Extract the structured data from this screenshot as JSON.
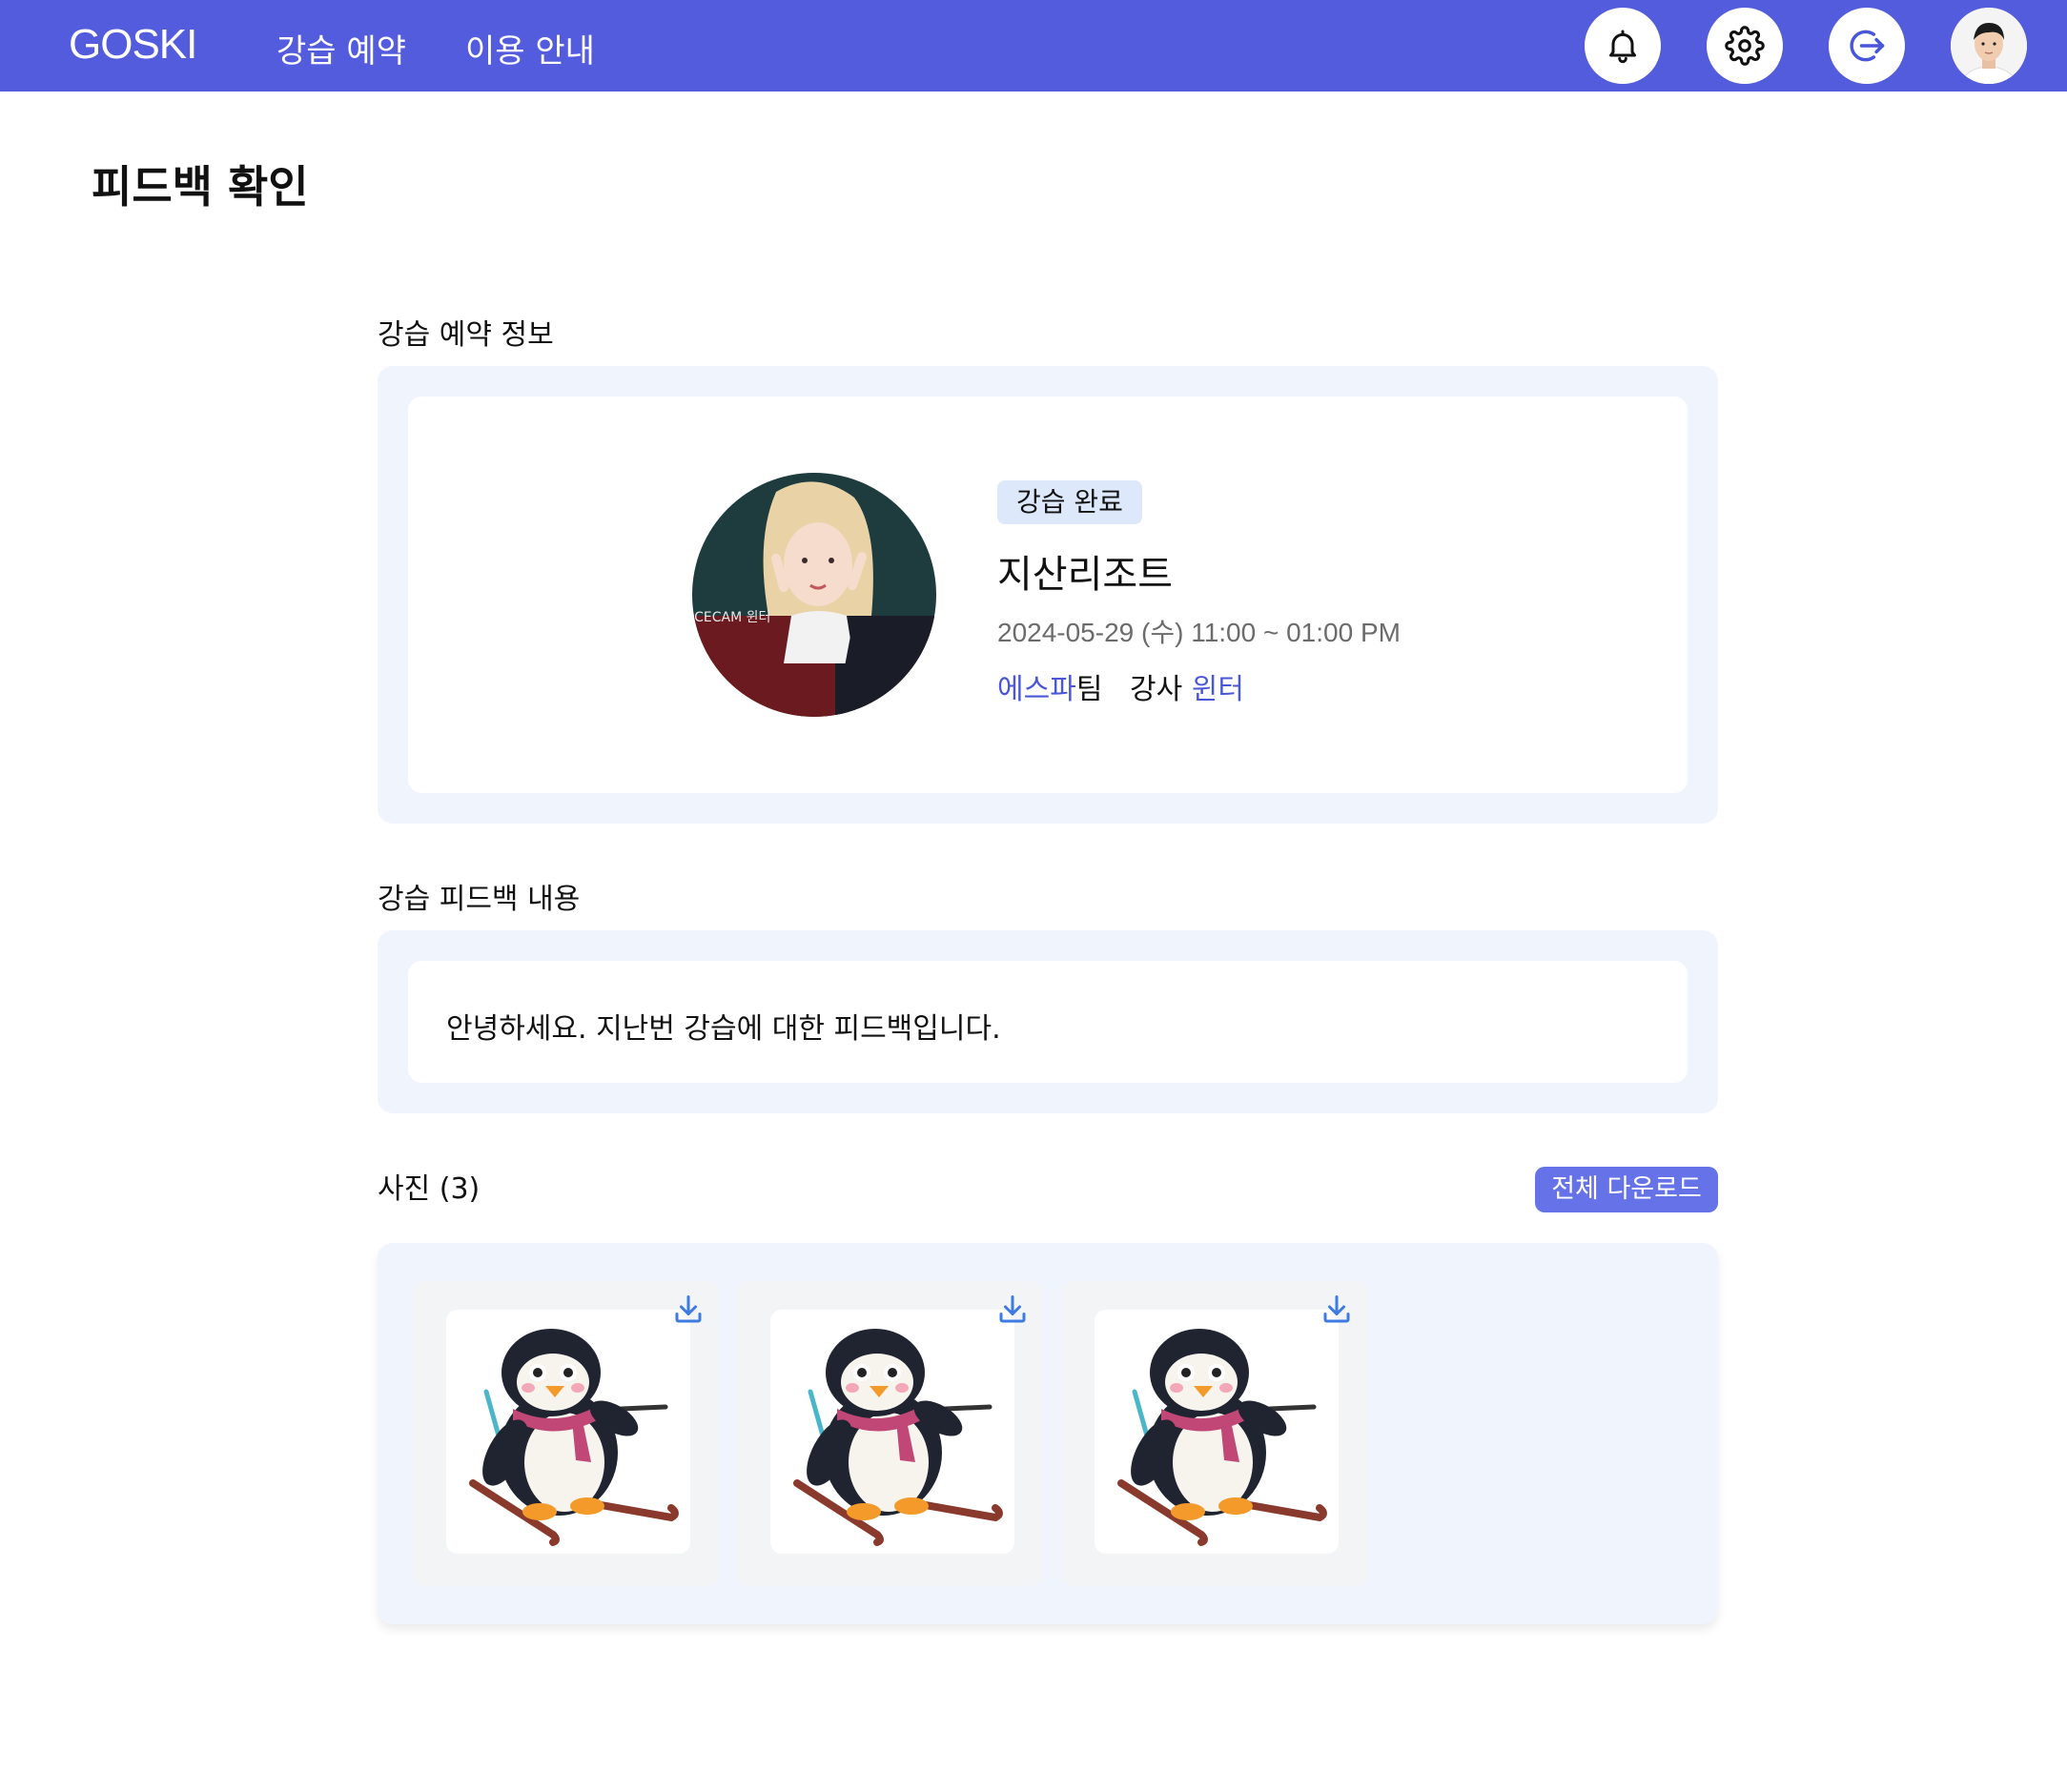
{
  "header": {
    "logo": "GOSKI",
    "nav": [
      "강습 예약",
      "이용 안내"
    ],
    "icons": [
      "bell-icon",
      "gear-icon",
      "logout-icon",
      "user-avatar"
    ],
    "color": "#525cdc"
  },
  "page": {
    "title": "피드백 확인"
  },
  "reservation": {
    "section_label": "강습 예약 정보",
    "status": "강습 완료",
    "resort": "지산리조트",
    "datetime": "2024-05-29 (수) 11:00 ~ 01:00 PM",
    "team_name": "에스파",
    "team_suffix": "팀",
    "instructor_prefix": "강사",
    "instructor_name": "윈터",
    "photo_overlay_text": "FACECAM 윈터"
  },
  "feedback": {
    "section_label": "강습 피드백 내용",
    "content": "안녕하세요. 지난번 강습에 대한 피드백입니다."
  },
  "photos": {
    "section_label": "사진 (3)",
    "download_all_label": "전체 다운로드",
    "items": [
      {
        "subject": "skiing penguin illustration"
      },
      {
        "subject": "skiing penguin illustration"
      },
      {
        "subject": "skiing penguin illustration"
      }
    ]
  },
  "colors": {
    "accent": "#4a56d8",
    "panel_bg": "#eff4fd",
    "badge_bg": "#dde8fb",
    "button_bg": "#6673e8"
  }
}
